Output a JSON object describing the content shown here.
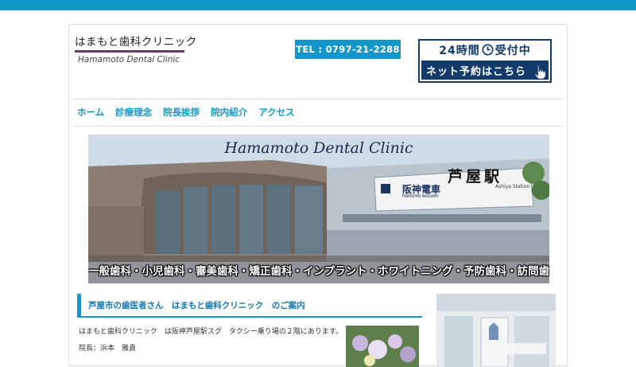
{
  "brand": {
    "logo_jp": "はまもと歯科クリニック",
    "logo_en": "Hamamoto Dental Clinic",
    "accent": "#1496c8",
    "logo_bar_color": "#6c3864",
    "navy": "#123a6a"
  },
  "header": {
    "tel": "TEL : 0797-21-2288",
    "reserve_top_left": "24時間",
    "reserve_top_right": "受付中",
    "reserve_bottom": "ネット予約はこちら",
    "clock_icon": "clock-icon",
    "hand_icon": "pointing-hand-icon"
  },
  "nav": {
    "items": [
      {
        "label": "ホーム"
      },
      {
        "label": "診療理念"
      },
      {
        "label": "院長挨拶"
      },
      {
        "label": "院内紹介"
      },
      {
        "label": "アクセス"
      }
    ]
  },
  "hero": {
    "title": "Hamamoto Dental Clinic",
    "sign_jp": "阪神電車",
    "sign_en": "HANSHIN RAILWAY",
    "station_jp": "芦屋駅",
    "station_en": "Ashiya Station",
    "services": "一般歯科・小児歯科・審美歯科・矯正歯科・インプラント・ホワイトニング・予防歯科・訪問歯科"
  },
  "intro": {
    "heading": "芦屋市の歯医者さん　はまもと歯科クリニック　のご案内",
    "line1": "はまもと歯科クリニック　は阪神芦屋駅スグ　タクシー乗り場の２階にあります。",
    "line2": "院長：浜本　雅貴"
  }
}
